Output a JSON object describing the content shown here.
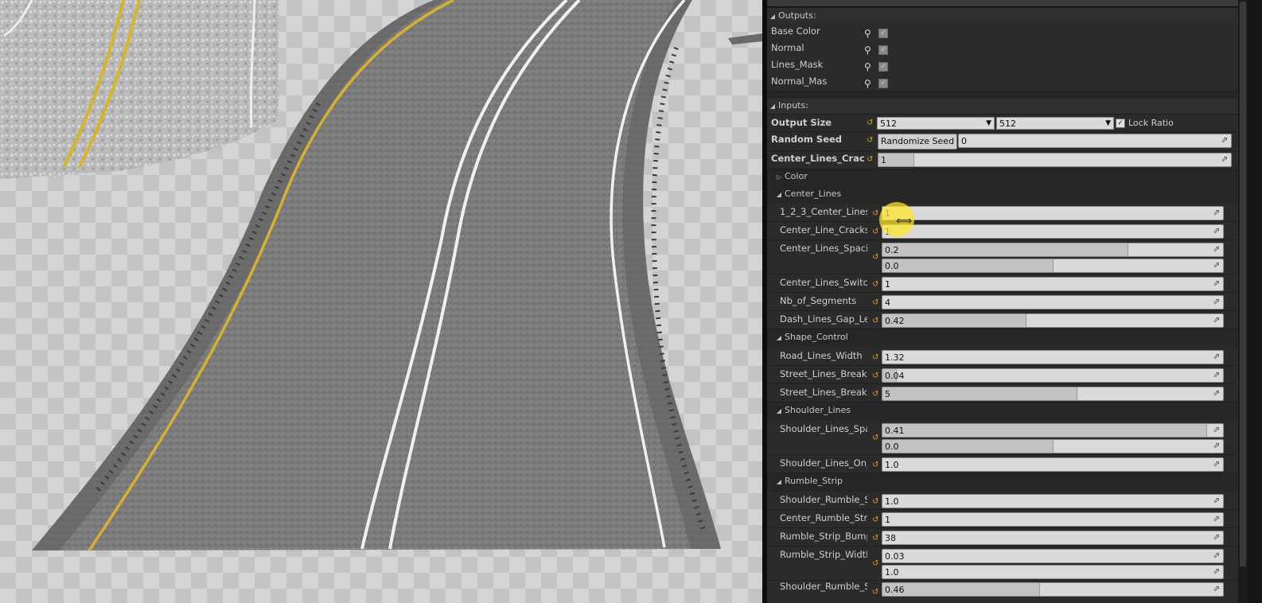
{
  "outputs": {
    "header": "Outputs:",
    "items": [
      {
        "label": "Base Color",
        "checked": true
      },
      {
        "label": "Normal",
        "checked": true
      },
      {
        "label": "Lines_Mask",
        "checked": true
      },
      {
        "label": "Normal_Mas",
        "checked": true
      }
    ]
  },
  "inputs": {
    "header": "Inputs:",
    "output_size": {
      "label": "Output Size",
      "width": "512",
      "height": "512",
      "lock_label": "Lock Ratio",
      "lock_checked": true
    },
    "random_seed": {
      "label": "Random Seed",
      "button": "Randomize Seed",
      "value": "0"
    },
    "center_lines_cracks": {
      "label": "Center_Lines_Cracks_F",
      "value": "1"
    }
  },
  "groups": {
    "color": "Color",
    "center_lines": {
      "header": "Center_Lines",
      "params": [
        {
          "label": "1_2_3_Center_Lines",
          "value": "1"
        },
        {
          "label": "Center_Line_Cracks_C",
          "value": "1"
        },
        {
          "label": "Center_Lines_Spacing",
          "value": "0.2",
          "value2": "0.0"
        },
        {
          "label": "Center_Lines_Switch",
          "value": "1"
        },
        {
          "label": "Nb_of_Segments",
          "value": "4"
        },
        {
          "label": "Dash_Lines_Gap_Leng",
          "value": "0.42"
        }
      ]
    },
    "shape_control": {
      "header": "Shape_Control",
      "params": [
        {
          "label": "Road_Lines_Width",
          "value": "1.32"
        },
        {
          "label": "Street_Lines_Breakup",
          "value": "0.04"
        },
        {
          "label": "Street_Lines_Breakup",
          "value": "5"
        }
      ]
    },
    "shoulder_lines": {
      "header": "Shoulder_Lines",
      "params": [
        {
          "label": "Shoulder_Lines_Spac",
          "value": "0.41",
          "value2": "0.0"
        },
        {
          "label": "Shoulder_Lines_On_O",
          "value": "1.0"
        }
      ]
    },
    "rumble_strip": {
      "header": "Rumble_Strip",
      "params": [
        {
          "label": "Shoulder_Rumble_Str",
          "value": "1.0"
        },
        {
          "label": "Center_Rumble_Strip_",
          "value": "1"
        },
        {
          "label": "Rumble_Strip_Bump_",
          "value": "38"
        },
        {
          "label": "Rumble_Strip_Width",
          "value": "0.03",
          "value2": "1.0"
        },
        {
          "label": "Shoulder_Rumble_Str",
          "value": "0.46"
        }
      ]
    }
  },
  "fills": {
    "center_lines_cracks": 0.1,
    "p1": 0.0,
    "p2": 0.0,
    "p3a": 0.72,
    "p3b": 0.5,
    "p4": 0.0,
    "p5": 0.0,
    "p6": 0.42,
    "s1": 0.0,
    "s2": 0.04,
    "s3": 0.57,
    "sh1a": 0.95,
    "sh1b": 0.5,
    "sh2": 0.0,
    "r1": 0.0,
    "r2": 0.0,
    "r3": 0.0,
    "r4a": 0.0,
    "r4b": 0.0,
    "r5": 0.46
  },
  "colors": {
    "accent_cursor": "#ffe828",
    "panel_bg": "#262626",
    "field_bg": "#dadada",
    "reset_icon": "#d8a030"
  }
}
